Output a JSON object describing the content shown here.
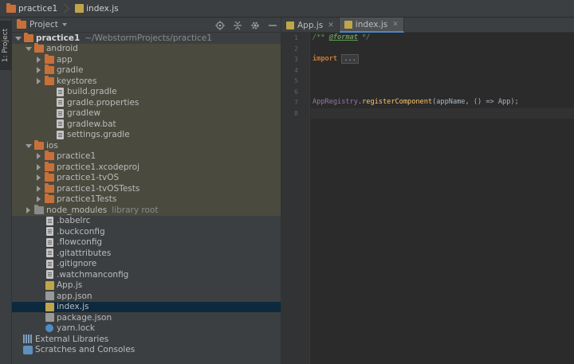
{
  "breadcrumbs": [
    {
      "label": "practice1",
      "icon": "folder-icon"
    },
    {
      "label": "index.js",
      "icon": "js-file-icon"
    }
  ],
  "left_strip": {
    "tab_label": "1: Project"
  },
  "project_panel": {
    "title": "Project",
    "header_icons": [
      "locate-icon",
      "collapse-all-icon",
      "gear-icon",
      "hide-icon"
    ]
  },
  "tree": [
    {
      "label": "practice1",
      "suffix": "~/WebstormProjects/practice1",
      "depth": 0,
      "arrow": "open",
      "icon": "folder",
      "bold": true
    },
    {
      "label": "android",
      "depth": 1,
      "arrow": "open",
      "icon": "folder",
      "hl": true
    },
    {
      "label": "app",
      "depth": 2,
      "arrow": "closed",
      "icon": "folder",
      "hl": true
    },
    {
      "label": "gradle",
      "depth": 2,
      "arrow": "closed",
      "icon": "folder",
      "hl": true
    },
    {
      "label": "keystores",
      "depth": 2,
      "arrow": "closed",
      "icon": "folder",
      "hl": true
    },
    {
      "label": "build.gradle",
      "depth": 3,
      "arrow": "",
      "icon": "file",
      "hl": true
    },
    {
      "label": "gradle.properties",
      "depth": 3,
      "arrow": "",
      "icon": "file",
      "hl": true
    },
    {
      "label": "gradlew",
      "depth": 3,
      "arrow": "",
      "icon": "file",
      "hl": true
    },
    {
      "label": "gradlew.bat",
      "depth": 3,
      "arrow": "",
      "icon": "file",
      "hl": true
    },
    {
      "label": "settings.gradle",
      "depth": 3,
      "arrow": "",
      "icon": "file",
      "hl": true
    },
    {
      "label": "ios",
      "depth": 1,
      "arrow": "open",
      "icon": "folder",
      "hl": true
    },
    {
      "label": "practice1",
      "depth": 2,
      "arrow": "closed",
      "icon": "folder",
      "hl": true
    },
    {
      "label": "practice1.xcodeproj",
      "depth": 2,
      "arrow": "closed",
      "icon": "folder",
      "hl": true
    },
    {
      "label": "practice1-tvOS",
      "depth": 2,
      "arrow": "closed",
      "icon": "folder",
      "hl": true
    },
    {
      "label": "practice1-tvOSTests",
      "depth": 2,
      "arrow": "closed",
      "icon": "folder",
      "hl": true
    },
    {
      "label": "practice1Tests",
      "depth": 2,
      "arrow": "closed",
      "icon": "folder",
      "hl": true
    },
    {
      "label": "node_modules",
      "suffix": "library root",
      "depth": 1,
      "arrow": "closed",
      "icon": "folder-grey",
      "hl": true
    },
    {
      "label": ".babelrc",
      "depth": 2,
      "arrow": "",
      "icon": "file"
    },
    {
      "label": ".buckconfig",
      "depth": 2,
      "arrow": "",
      "icon": "file"
    },
    {
      "label": ".flowconfig",
      "depth": 2,
      "arrow": "",
      "icon": "file"
    },
    {
      "label": ".gitattributes",
      "depth": 2,
      "arrow": "",
      "icon": "file"
    },
    {
      "label": ".gitignore",
      "depth": 2,
      "arrow": "",
      "icon": "file"
    },
    {
      "label": ".watchmanconfig",
      "depth": 2,
      "arrow": "",
      "icon": "file"
    },
    {
      "label": "App.js",
      "depth": 2,
      "arrow": "",
      "icon": "js"
    },
    {
      "label": "app.json",
      "depth": 2,
      "arrow": "",
      "icon": "json"
    },
    {
      "label": "index.js",
      "depth": 2,
      "arrow": "",
      "icon": "js",
      "selected": true
    },
    {
      "label": "package.json",
      "depth": 2,
      "arrow": "",
      "icon": "json"
    },
    {
      "label": "yarn.lock",
      "depth": 2,
      "arrow": "",
      "icon": "yarn"
    },
    {
      "label": "External Libraries",
      "depth": 0,
      "arrow": "",
      "icon": "libs"
    },
    {
      "label": "Scratches and Consoles",
      "depth": 0,
      "arrow": "",
      "icon": "scratch"
    }
  ],
  "editor": {
    "tabs": [
      {
        "label": "App.js",
        "active": false
      },
      {
        "label": "index.js",
        "active": true
      }
    ],
    "line_numbers": [
      "1",
      "2",
      "3",
      "4",
      "5",
      "6",
      "7",
      "8"
    ],
    "code": {
      "l1_open": "/** ",
      "l1_tag": "@format",
      "l1_close": " */",
      "l3_kw": "import",
      "l3_fold": "...",
      "l7_cls": "AppRegistry",
      "l7_dot": ".",
      "l7_fn": "registerComponent",
      "l7_rest": "(appName, () => App);"
    }
  }
}
